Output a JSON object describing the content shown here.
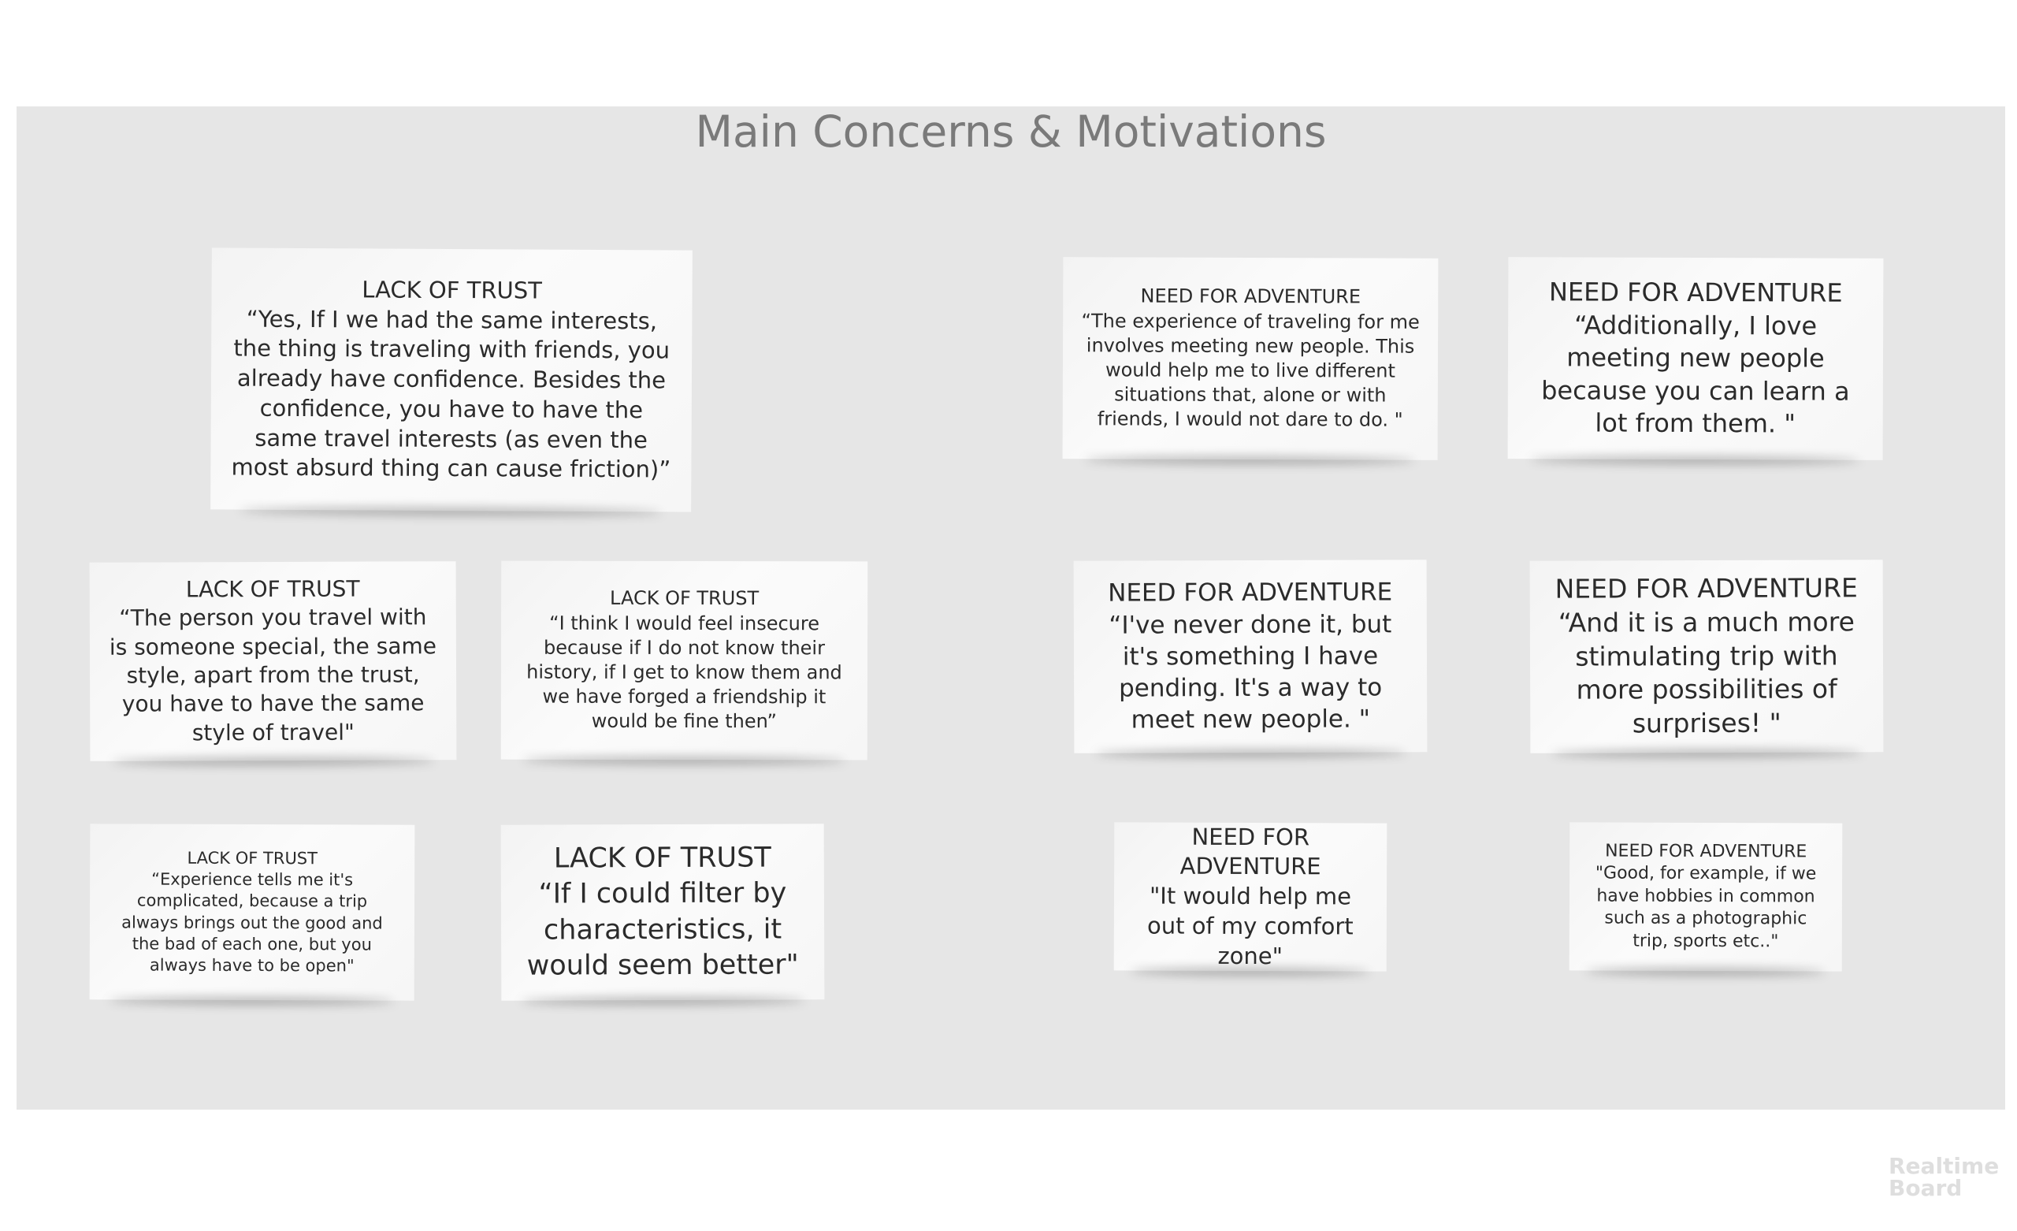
{
  "board": {
    "title": "Main Concerns & Motivations"
  },
  "notes": [
    {
      "category": "LACK OF TRUST",
      "quote": "“Yes, If I we had the same interests, the thing is traveling with friends, you already have confidence. Besides the confidence, you have to have the same travel interests (as even the most absurd thing can cause friction)”"
    },
    {
      "category": "LACK OF TRUST",
      "quote": "“The person you travel with is someone special, the same style, apart from the trust, you have to have the same style of travel\""
    },
    {
      "category": "LACK OF TRUST",
      "quote": "“I think I would feel insecure because if I do not know their history, if I get to know them and we have forged a friendship it would be fine then”"
    },
    {
      "category": "LACK OF TRUST",
      "quote": "“Experience tells me it's complicated, because a trip always brings out the good and the bad of each one, but you always have to be open\""
    },
    {
      "category": "LACK OF TRUST",
      "quote": "“If I could filter by characteristics, it would seem better\""
    },
    {
      "category": "NEED FOR ADVENTURE",
      "quote": "“The experience of traveling for me involves meeting new people. This would help me to live different situations that, alone or with friends, I would not dare to do. \""
    },
    {
      "category": "NEED FOR ADVENTURE",
      "quote": "“Additionally, I love meeting new people because you can learn a lot from them. \""
    },
    {
      "category": "NEED FOR ADVENTURE",
      "quote": "“I've never done it, but it's something I have pending. It's a way to meet new people. \""
    },
    {
      "category": "NEED FOR ADVENTURE",
      "quote": "“And it is a much more stimulating trip with more possibilities of surprises! \""
    },
    {
      "category": "NEED FOR ADVENTURE",
      "quote": "\"It would help me out of my comfort zone\""
    },
    {
      "category": "NEED FOR ADVENTURE",
      "quote": "\"Good, for example, if we have hobbies in common such as a photographic trip, sports etc..\""
    }
  ],
  "watermark": {
    "line1": "Realtime",
    "line2": "Board"
  }
}
